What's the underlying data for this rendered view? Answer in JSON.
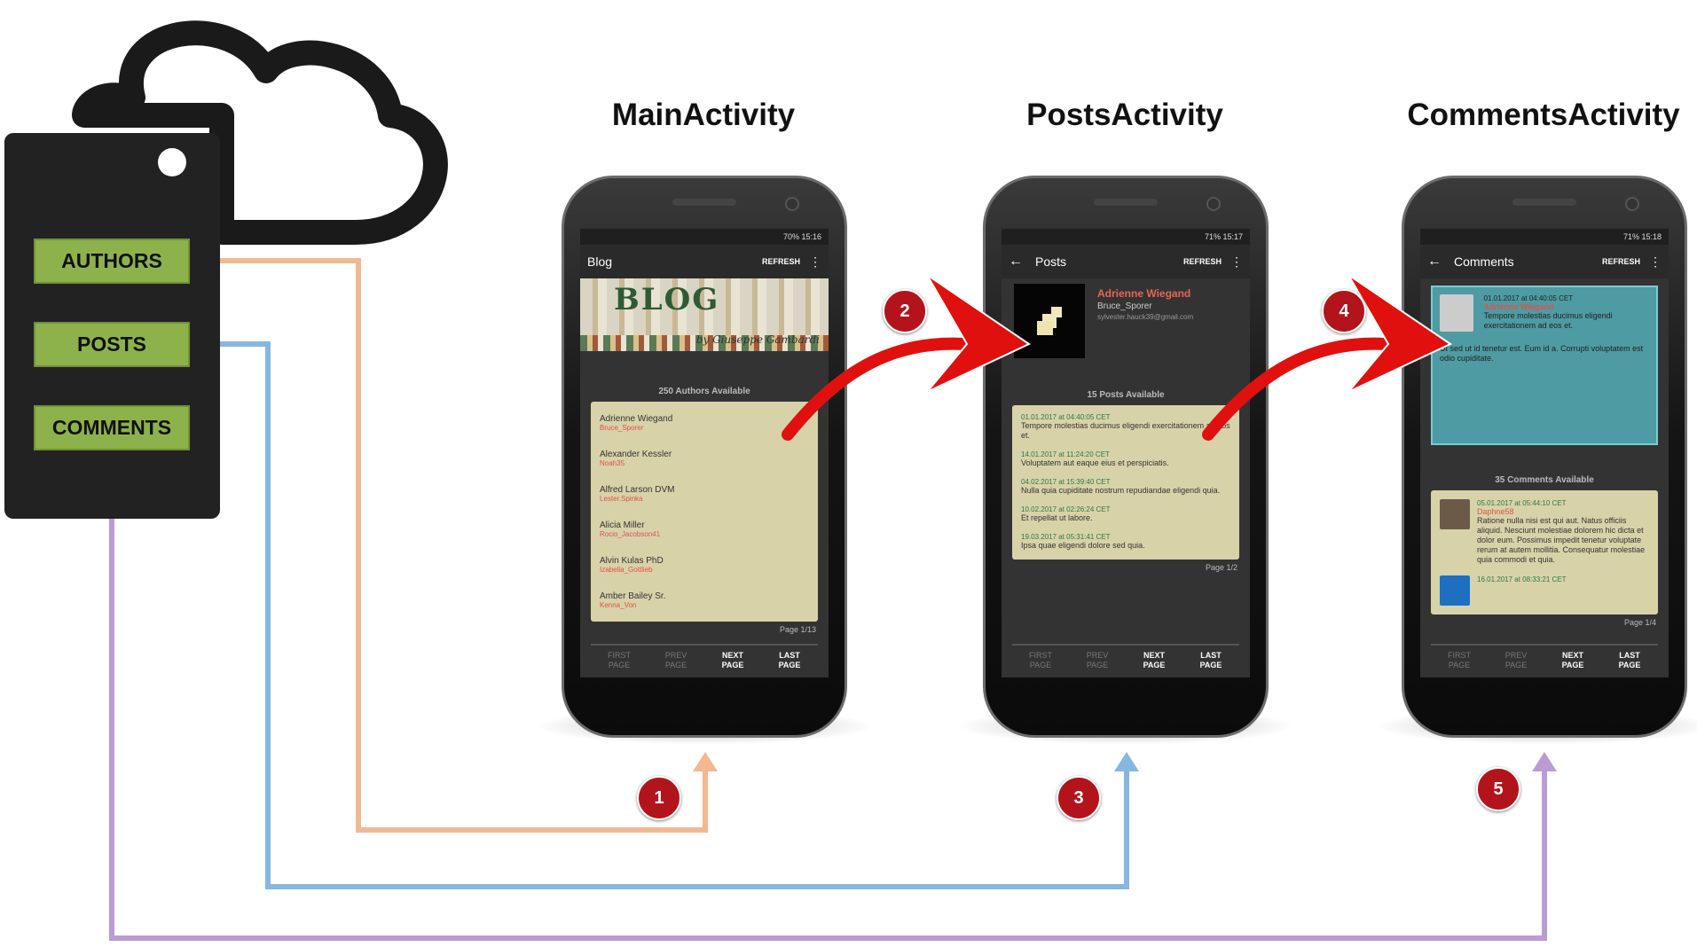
{
  "diagram": {
    "api": {
      "authors": "AUTHORS",
      "posts": "POSTS",
      "comments": "COMMENTS"
    },
    "colors": {
      "authors_link": "#f2b990",
      "posts_link": "#86b7e0",
      "comments_link": "#bb9bd3",
      "flow_arrow": "#e0100f",
      "badge": "#b3141b"
    },
    "steps": [
      "1",
      "2",
      "3",
      "4",
      "5"
    ],
    "activities": [
      {
        "title": "MainActivity",
        "status": "70% 15:16",
        "app_title": "Blog",
        "refresh": "REFRESH",
        "banner_title": "BLOG",
        "banner_sub": "by Giuseppe Gambardi",
        "available": "250 Authors Available",
        "authors": [
          {
            "name": "Adrienne Wiegand",
            "user": "Bruce_Sporer"
          },
          {
            "name": "Alexander Kessler",
            "user": "Noah35"
          },
          {
            "name": "Alfred Larson DVM",
            "user": "Lester.Spinka"
          },
          {
            "name": "Alicia Miller",
            "user": "Rocio_Jacobson41"
          },
          {
            "name": "Alvin Kulas PhD",
            "user": "Izabella_Gottlieb"
          },
          {
            "name": "Amber Bailey Sr.",
            "user": "Kenna_Von"
          }
        ],
        "page": "Page 1/13",
        "pager": [
          "FIRST PAGE",
          "PREV PAGE",
          "NEXT PAGE",
          "LAST PAGE"
        ]
      },
      {
        "title": "PostsActivity",
        "status": "71% 15:17",
        "app_title": "Posts",
        "refresh": "REFRESH",
        "author_name": "Adrienne Wiegand",
        "author_user": "Bruce_Sporer",
        "author_email": "sylvester.hauck39@gmail.com",
        "available": "15 Posts Available",
        "posts": [
          {
            "date": "01.01.2017 at 04:40:05 CET",
            "text": "Tempore molestias ducimus eligendi exercitationem ad eos et."
          },
          {
            "date": "14.01.2017 at 11:24:20 CET",
            "text": "Voluptatem aut eaque eius et perspiciatis."
          },
          {
            "date": "04.02.2017 at 15:39:40 CET",
            "text": "Nulla quia cupiditate nostrum repudiandae eligendi quia."
          },
          {
            "date": "10.02.2017 at 02:26:24 CET",
            "text": "Et repellat ut labore."
          },
          {
            "date": "19.03.2017 at 05:31:41 CET",
            "text": "Ipsa quae eligendi dolore sed quia."
          }
        ],
        "page": "Page 1/2",
        "pager": [
          "FIRST PAGE",
          "PREV PAGE",
          "NEXT PAGE",
          "LAST PAGE"
        ]
      },
      {
        "title": "CommentsActivity",
        "status": "71% 15:18",
        "app_title": "Comments",
        "refresh": "REFRESH",
        "post": {
          "date": "01.01.2017 at 04:40:05 CET",
          "author": "Adrienne Wiegand",
          "title": "Tempore molestias ducimus eligendi exercitationem ad eos et.",
          "body": "Ut sed ut id tenetur est. Eum id a. Corrupti voluptatem est odio cupiditate."
        },
        "available": "35 Comments Available",
        "comments": [
          {
            "date": "05.01.2017 at 05:44:10 CET",
            "user": "Daphne58",
            "text": "Ratione nulla nisi est qui aut. Natus officiis aliquid. Nesciunt molestiae dolorem hic dicta et dolor eum. Possimus impedit tenetur voluptate rerum at autem mollitia. Consequatur molestiae quia commodi et quia."
          },
          {
            "date": "16.01.2017 at 08:33:21 CET",
            "user": "",
            "text": ""
          }
        ],
        "page": "Page 1/4",
        "pager": [
          "FIRST PAGE",
          "PREV PAGE",
          "NEXT PAGE",
          "LAST PAGE"
        ]
      }
    ]
  }
}
